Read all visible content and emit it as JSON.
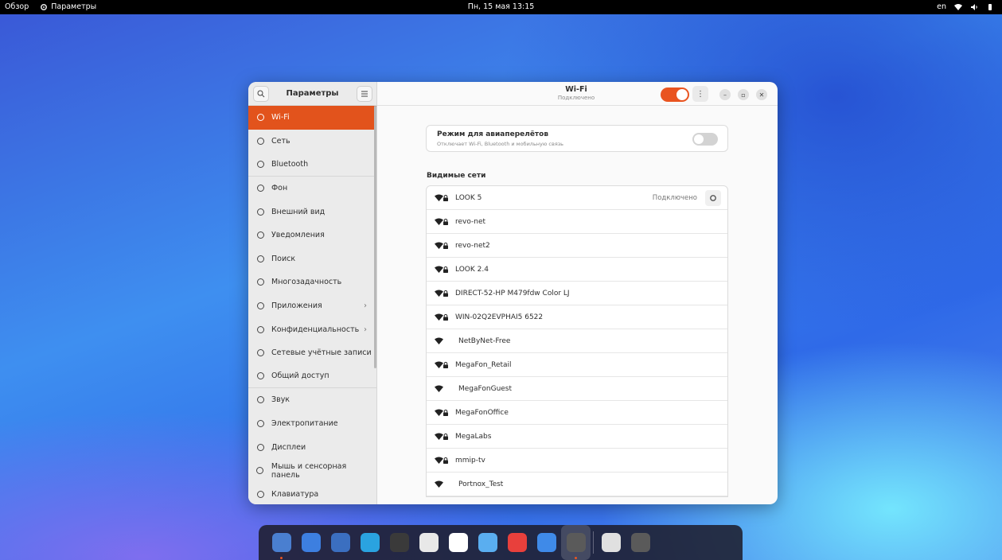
{
  "topbar": {
    "overview": "Обзор",
    "app_name": "Параметры",
    "clock": "Пн, 15 мая 13:15",
    "lang": "en"
  },
  "sidebar": {
    "title": "Параметры",
    "items": [
      {
        "label": "Wi-Fi",
        "icon": "wifi-icon",
        "active": true
      },
      {
        "label": "Сеть",
        "icon": "network-icon"
      },
      {
        "label": "Bluetooth",
        "icon": "bluetooth-icon"
      },
      {
        "label": "Фон",
        "icon": "background-icon"
      },
      {
        "label": "Внешний вид",
        "icon": "appearance-icon"
      },
      {
        "label": "Уведомления",
        "icon": "bell-icon"
      },
      {
        "label": "Поиск",
        "icon": "search-icon"
      },
      {
        "label": "Многозадачность",
        "icon": "multitasking-icon"
      },
      {
        "label": "Приложения",
        "icon": "apps-icon",
        "chevron": true
      },
      {
        "label": "Конфиденциальность",
        "icon": "lock-icon",
        "chevron": true
      },
      {
        "label": "Сетевые учётные записи",
        "icon": "cloud-icon"
      },
      {
        "label": "Общий доступ",
        "icon": "share-icon"
      },
      {
        "label": "Звук",
        "icon": "music-note-icon"
      },
      {
        "label": "Электропитание",
        "icon": "power-icon"
      },
      {
        "label": "Дисплеи",
        "icon": "display-icon"
      },
      {
        "label": "Мышь и сенсорная панель",
        "icon": "mouse-icon"
      },
      {
        "label": "Клавиатура",
        "icon": "keyboard-icon"
      }
    ]
  },
  "header": {
    "title": "Wi-Fi",
    "subtitle": "Подключено"
  },
  "airplane": {
    "title": "Режим для авиаперелётов",
    "subtitle": "Отключает Wi-Fi, Bluetooth и мобильную связь"
  },
  "networks": {
    "section_title": "Видимые сети",
    "connected_label": "Подключено",
    "items": [
      {
        "name": "LOOK 5",
        "secured": true,
        "connected": true
      },
      {
        "name": "revo-net",
        "secured": true
      },
      {
        "name": "revo-net2",
        "secured": true
      },
      {
        "name": "LOOK 2.4",
        "secured": true
      },
      {
        "name": "DIRECT-52-HP M479fdw Color LJ",
        "secured": true
      },
      {
        "name": "WIN-02Q2EVPHAI5 6522",
        "secured": true
      },
      {
        "name": "NetByNet-Free",
        "secured": false
      },
      {
        "name": "MegaFon_Retail",
        "secured": true
      },
      {
        "name": "MegaFonGuest",
        "secured": false
      },
      {
        "name": "MegaFonOffice",
        "secured": true
      },
      {
        "name": "MegaLabs",
        "secured": true
      },
      {
        "name": "mmip-tv",
        "secured": true
      },
      {
        "name": "Portnox_Test",
        "secured": false
      }
    ]
  },
  "dock": [
    {
      "name": "files-icon",
      "color": "#4a7fd0",
      "running": true
    },
    {
      "name": "chromium-icon",
      "color": "#3d7fe0"
    },
    {
      "name": "thunderbird-icon",
      "color": "#3b6fc0"
    },
    {
      "name": "telegram-icon",
      "color": "#2aa3e0"
    },
    {
      "name": "photos-icon",
      "color": "#3a3a3a"
    },
    {
      "name": "notes-icon",
      "color": "#e8e8e8"
    },
    {
      "name": "calendar-icon",
      "color": "#ffffff"
    },
    {
      "name": "image-viewer-icon",
      "color": "#5aaef0"
    },
    {
      "name": "music-icon",
      "color": "#e8403c"
    },
    {
      "name": "app-store-icon",
      "color": "#3f8ae8"
    },
    {
      "name": "settings-icon",
      "color": "#5a5a5a",
      "running": true,
      "active": true
    },
    {
      "name": "trash-icon",
      "color": "#e0e0e0"
    },
    {
      "name": "app-grid-icon",
      "color": "#5a5a5a"
    }
  ]
}
